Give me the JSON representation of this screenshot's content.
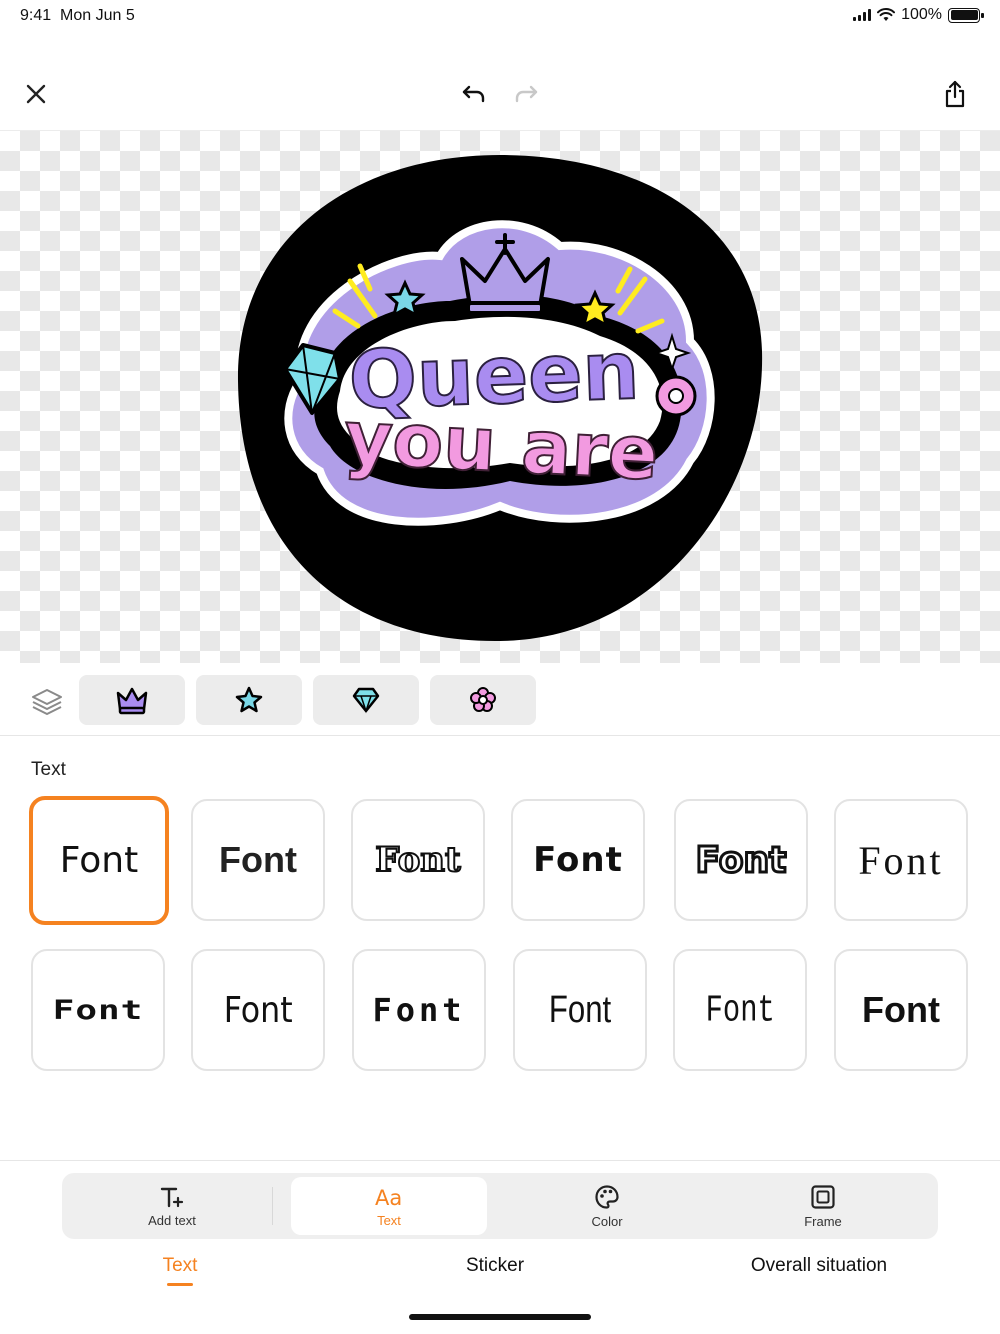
{
  "status_bar": {
    "time": "9:41",
    "date": "Mon Jun 5",
    "battery_text": "100%",
    "battery_level": 1.0
  },
  "toolbar": {
    "close_icon": "close-icon",
    "undo_icon": "undo-icon",
    "redo_icon": "redo-icon",
    "share_icon": "share-icon"
  },
  "sticker": {
    "line1": "Queen",
    "line2": "you are",
    "colors": {
      "background": "#000000",
      "outline": "#b09ee8",
      "queen": "#a98cf0",
      "you_are": "#f29ae0",
      "gem": "#7fe0ea",
      "star_yellow": "#ffec1f",
      "star_cyan": "#7ad7e6"
    }
  },
  "layers": {
    "icon": "layers-icon",
    "chips": [
      {
        "icon": "crown-icon",
        "color": "#a98cf0"
      },
      {
        "icon": "star-icon",
        "color": "#7ad7e6"
      },
      {
        "icon": "diamond-icon",
        "color": "#7fe0ea"
      },
      {
        "icon": "flower-icon",
        "color": "#f29ae0"
      }
    ]
  },
  "text_section": {
    "label": "Text",
    "fonts": [
      {
        "label": "Font",
        "selected": true
      },
      {
        "label": "Font",
        "selected": false
      },
      {
        "label": "Font",
        "selected": false
      },
      {
        "label": "Font",
        "selected": false
      },
      {
        "label": "Font",
        "selected": false
      },
      {
        "label": "Font",
        "selected": false
      },
      {
        "label": "Font",
        "selected": false
      },
      {
        "label": "Font",
        "selected": false
      },
      {
        "label": "Font",
        "selected": false
      },
      {
        "label": "Font",
        "selected": false
      },
      {
        "label": "Font",
        "selected": false
      },
      {
        "label": "Font",
        "selected": false
      }
    ]
  },
  "tools": [
    {
      "label": "Add text",
      "icon": "add-text-icon",
      "active": false
    },
    {
      "label": "Text",
      "icon": "text-style-icon",
      "active": true
    },
    {
      "label": "Color",
      "icon": "palette-icon",
      "active": false
    },
    {
      "label": "Frame",
      "icon": "frame-icon",
      "active": false
    }
  ],
  "bottom_tabs": [
    {
      "label": "Text",
      "active": true
    },
    {
      "label": "Sticker",
      "active": false
    },
    {
      "label": "Overall situation",
      "active": false
    }
  ],
  "accent_color": "#f58220"
}
